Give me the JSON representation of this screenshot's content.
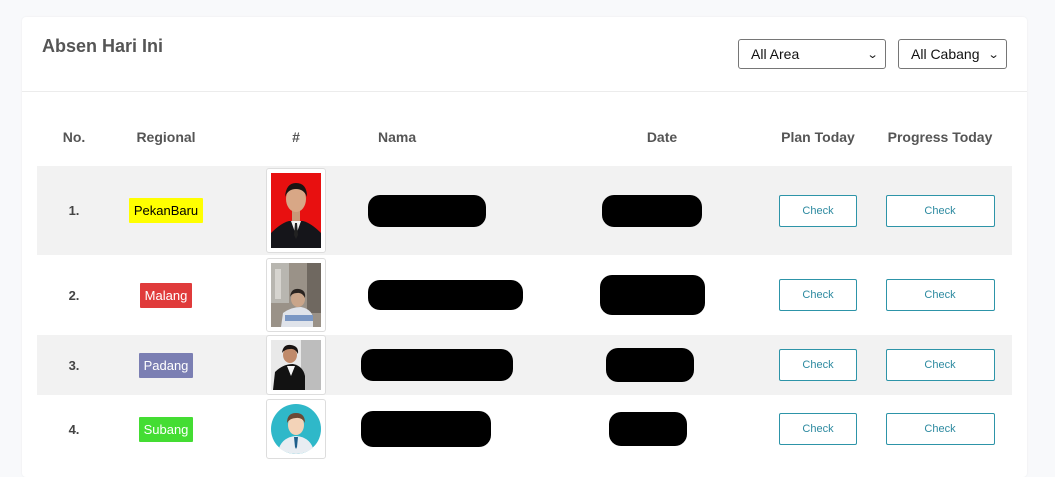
{
  "card": {
    "title": "Absen Hari Ini",
    "area_filter": {
      "selected": "All Area"
    },
    "cabang_filter": {
      "selected": "All Cabang"
    }
  },
  "table": {
    "headers": [
      "No.",
      "Regional",
      "#",
      "Nama",
      "Date",
      "Plan Today",
      "Progress Today"
    ],
    "rows": [
      {
        "no": "1.",
        "regional": "PekanBaru",
        "badge_color": "#ffff00",
        "badge_text_color": "#000000",
        "plan": "Check",
        "progress": "Check"
      },
      {
        "no": "2.",
        "regional": "Malang",
        "badge_color": "#e03b3b",
        "badge_text_color": "#ffffff",
        "plan": "Check",
        "progress": "Check"
      },
      {
        "no": "3.",
        "regional": "Padang",
        "badge_color": "#7b7fb3",
        "badge_text_color": "#ffffff",
        "plan": "Check",
        "progress": "Check"
      },
      {
        "no": "4.",
        "regional": "Subang",
        "badge_color": "#44dd33",
        "badge_text_color": "#ffffff",
        "plan": "Check",
        "progress": "Check"
      }
    ]
  },
  "colors": {
    "accent": "#2d94a8",
    "row_shade": "#f2f2f2"
  }
}
